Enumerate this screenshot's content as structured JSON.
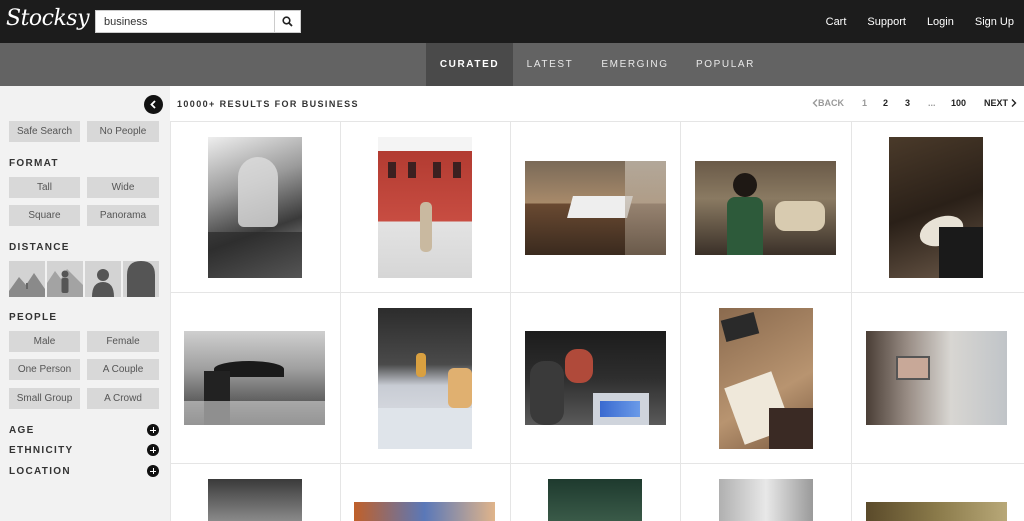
{
  "brand": {
    "logo_text": "Stocksy"
  },
  "search": {
    "value": "business",
    "placeholder": ""
  },
  "topnav": {
    "cart": "Cart",
    "support": "Support",
    "login": "Login",
    "signup": "Sign Up"
  },
  "tabs": [
    "CURATED",
    "LATEST",
    "EMERGING",
    "POPULAR"
  ],
  "active_tab": "CURATED",
  "sidebar": {
    "safe_search": "Safe Search",
    "no_people": "No People",
    "format_label": "FORMAT",
    "format": [
      "Tall",
      "Wide",
      "Square",
      "Panorama"
    ],
    "distance_label": "DISTANCE",
    "distance_icons": [
      "distance-landscape-icon",
      "distance-full-body-icon",
      "distance-half-body-icon",
      "distance-close-up-icon"
    ],
    "people_label": "PEOPLE",
    "people": [
      "Male",
      "Female",
      "One Person",
      "A Couple",
      "Small Group",
      "A Crowd"
    ],
    "age_label": "AGE",
    "ethnicity_label": "ETHNICITY",
    "location_label": "LOCATION"
  },
  "results": {
    "title": "10000+ RESULTS FOR BUSINESS",
    "back": "BACK",
    "pages": [
      "1",
      "2",
      "3",
      "...",
      "100"
    ],
    "next": "NEXT"
  },
  "colors": {
    "topbar": "#1c1c1c",
    "tabbar": "#636363",
    "tab_active": "#4a4a4a",
    "sidebar_bg": "#f2f2f2",
    "chip": "#d8d8d8"
  }
}
